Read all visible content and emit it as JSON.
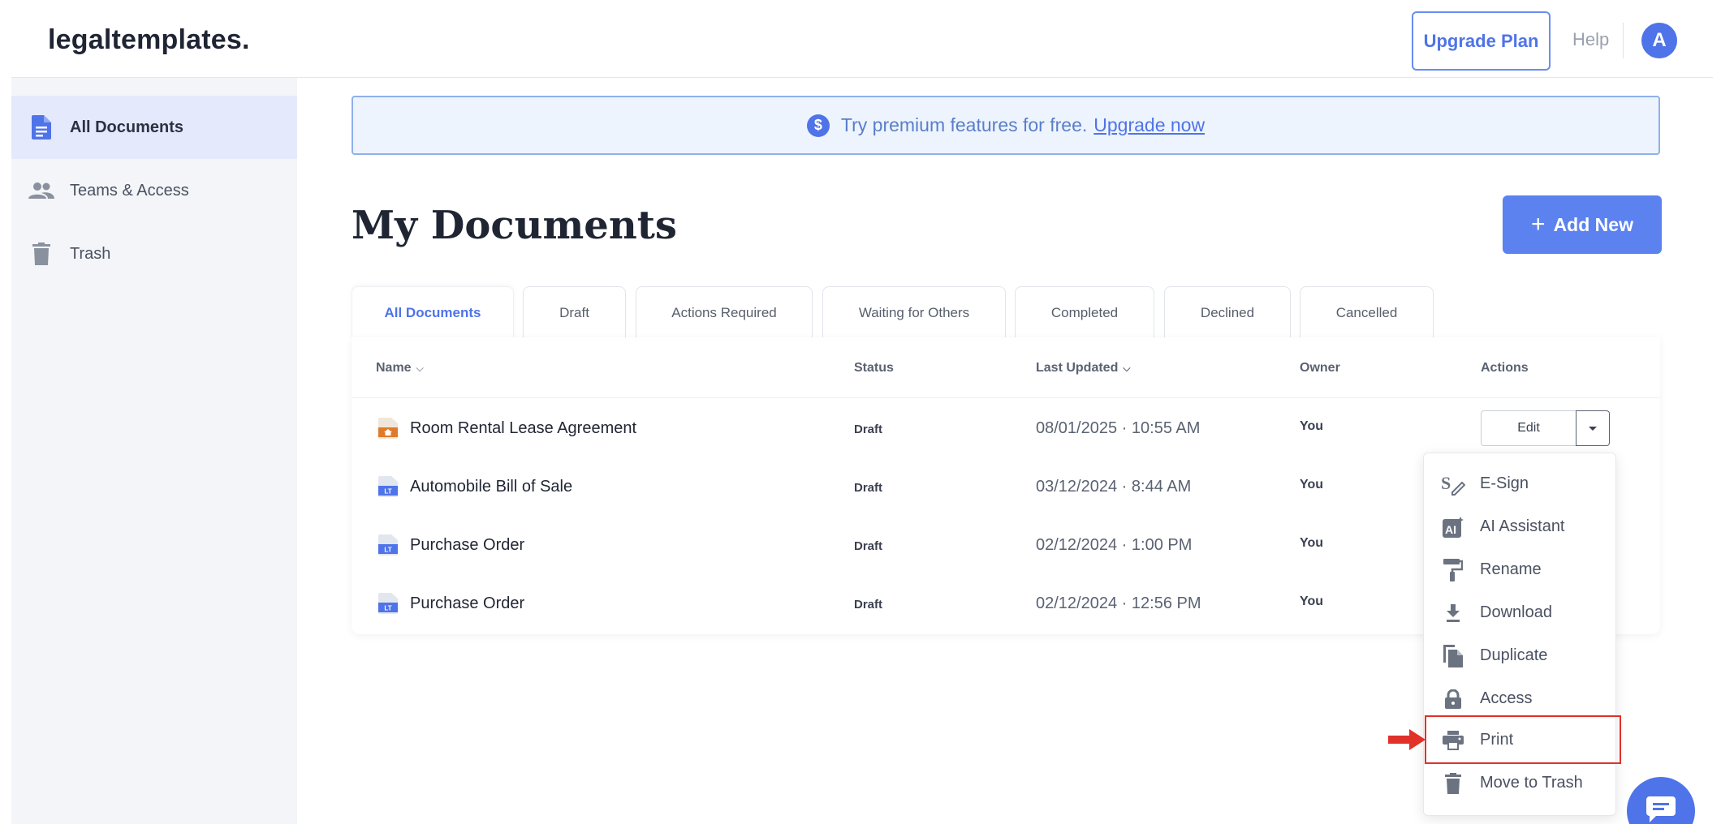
{
  "header": {
    "logo": "legaltemplates.",
    "upgrade_label": "Upgrade Plan",
    "help_label": "Help",
    "avatar_initial": "A"
  },
  "sidebar": {
    "items": [
      {
        "label": "All Documents",
        "icon": "document-icon",
        "active": true
      },
      {
        "label": "Teams & Access",
        "icon": "people-icon",
        "active": false
      },
      {
        "label": "Trash",
        "icon": "trash-icon",
        "active": false
      }
    ]
  },
  "banner": {
    "icon": "dollar-circle-icon",
    "text": "Try premium features for free.",
    "link": "Upgrade now"
  },
  "main": {
    "title": "My Documents",
    "add_new_label": "Add New",
    "tabs": [
      {
        "label": "All Documents",
        "active": true
      },
      {
        "label": "Draft"
      },
      {
        "label": "Actions Required"
      },
      {
        "label": "Waiting for Others"
      },
      {
        "label": "Completed"
      },
      {
        "label": "Declined"
      },
      {
        "label": "Cancelled"
      }
    ],
    "columns": [
      "Name",
      "Status",
      "Last Updated",
      "Owner",
      "Actions"
    ],
    "rows": [
      {
        "name": "Room Rental Lease Agreement",
        "status": "Draft",
        "date": "08/01/2025",
        "time": "10:55 AM",
        "owner": "You",
        "icon": "house-document-icon"
      },
      {
        "name": "Automobile Bill of Sale",
        "status": "Draft",
        "date": "03/12/2024",
        "time": "8:44 AM",
        "owner": "You",
        "icon": "lt-document-icon"
      },
      {
        "name": "Purchase Order",
        "status": "Draft",
        "date": "02/12/2024",
        "time": "1:00 PM",
        "owner": "You",
        "icon": "lt-document-icon"
      },
      {
        "name": "Purchase Order",
        "status": "Draft",
        "date": "02/12/2024",
        "time": "12:56 PM",
        "owner": "You",
        "icon": "lt-document-icon"
      }
    ],
    "edit_label": "Edit"
  },
  "menu": {
    "items": [
      {
        "label": "E-Sign",
        "icon": "esign-icon"
      },
      {
        "label": "AI Assistant",
        "icon": "ai-assistant-icon"
      },
      {
        "label": "Rename",
        "icon": "paint-roller-icon"
      },
      {
        "label": "Download",
        "icon": "download-icon"
      },
      {
        "label": "Duplicate",
        "icon": "duplicate-icon"
      },
      {
        "label": "Access",
        "icon": "lock-icon"
      },
      {
        "label": "Print",
        "icon": "printer-icon",
        "highlighted": true
      },
      {
        "label": "Move to Trash",
        "icon": "trash-icon"
      }
    ]
  },
  "colors": {
    "accent": "#4f73e8",
    "highlight": "#e0312a",
    "sidebar_bg": "#f3f5f8"
  }
}
